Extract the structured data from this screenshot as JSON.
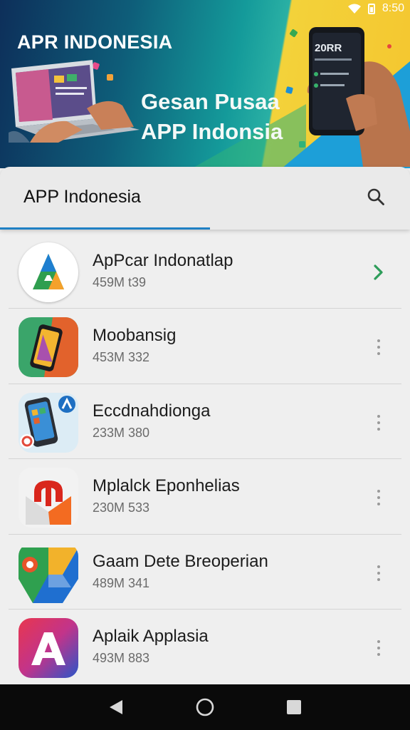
{
  "status_bar": {
    "time": "8:50"
  },
  "hero": {
    "title": "APR INDONESIA",
    "tagline_line1": "Gesan Pusaa",
    "tagline_line2": "APP Indonsia",
    "phone_screen_text": "20RR"
  },
  "search": {
    "title": "APP Indonesia",
    "icon": "search-icon"
  },
  "apps": [
    {
      "name": "ApPcar Indonatlap",
      "meta": "459M t39",
      "action": "chevron-right-icon"
    },
    {
      "name": "Moobansig",
      "meta": "453M 332",
      "action": "more-vert-icon"
    },
    {
      "name": "Eccdnahdionga",
      "meta": "233M 380",
      "action": "more-vert-icon"
    },
    {
      "name": "Mplalck Eponhelias",
      "meta": "230M 533",
      "action": "more-vert-icon"
    },
    {
      "name": "Gaam Dete Breoperian",
      "meta": "489M 341",
      "action": "more-vert-icon"
    },
    {
      "name": "Aplaik Applasia",
      "meta": "493M 883",
      "action": "more-vert-icon"
    }
  ],
  "navbar": {
    "back": "back-icon",
    "home": "home-icon",
    "recents": "recents-icon"
  },
  "colors": {
    "accent": "#1f80c4",
    "chevron": "#2e9d5a",
    "navbar": "#0a0a0a"
  }
}
